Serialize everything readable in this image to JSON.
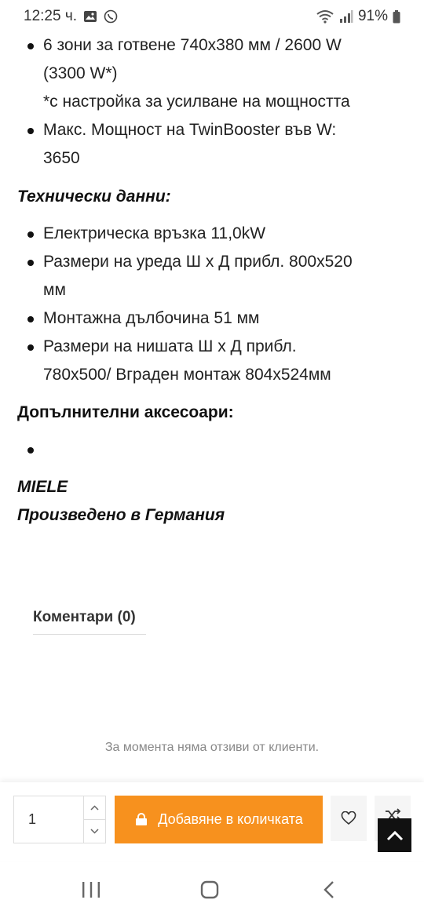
{
  "status_bar": {
    "time": "12:25 ч.",
    "battery": "91%"
  },
  "specs_list_1": [
    {
      "line1": "6 зони за готвене 740x380 мм / 2600 W",
      "line2": "(3300 W*)",
      "line3": "*с настройка за усилване на мощността"
    },
    {
      "line1": "Макс. Мощност на TwinBooster във W:",
      "line2": "3650"
    }
  ],
  "tech_heading": "Технически данни:",
  "tech_list": [
    {
      "line1": "Електрическа връзка 11,0kW"
    },
    {
      "line1": "Размери на уреда Ш x Д прибл. 800x520",
      "line2": "мм"
    },
    {
      "line1": "Монтажна дълбочина 51 мм"
    },
    {
      "line1": "Размери на нишата Ш x Д прибл.",
      "line2": "780x500/ Вграден монтаж 804x524мм"
    }
  ],
  "accessories_heading": "Допълнителни аксесоари:",
  "brand": "MIELE",
  "made_in": "Произведено в Германия",
  "comments_tab": "Коментари (0)",
  "no_reviews": "За момента няма отзиви от клиенти.",
  "cart": {
    "quantity": "1",
    "add_label": "Добавяне в количката",
    "accent_color": "#f7911e"
  }
}
